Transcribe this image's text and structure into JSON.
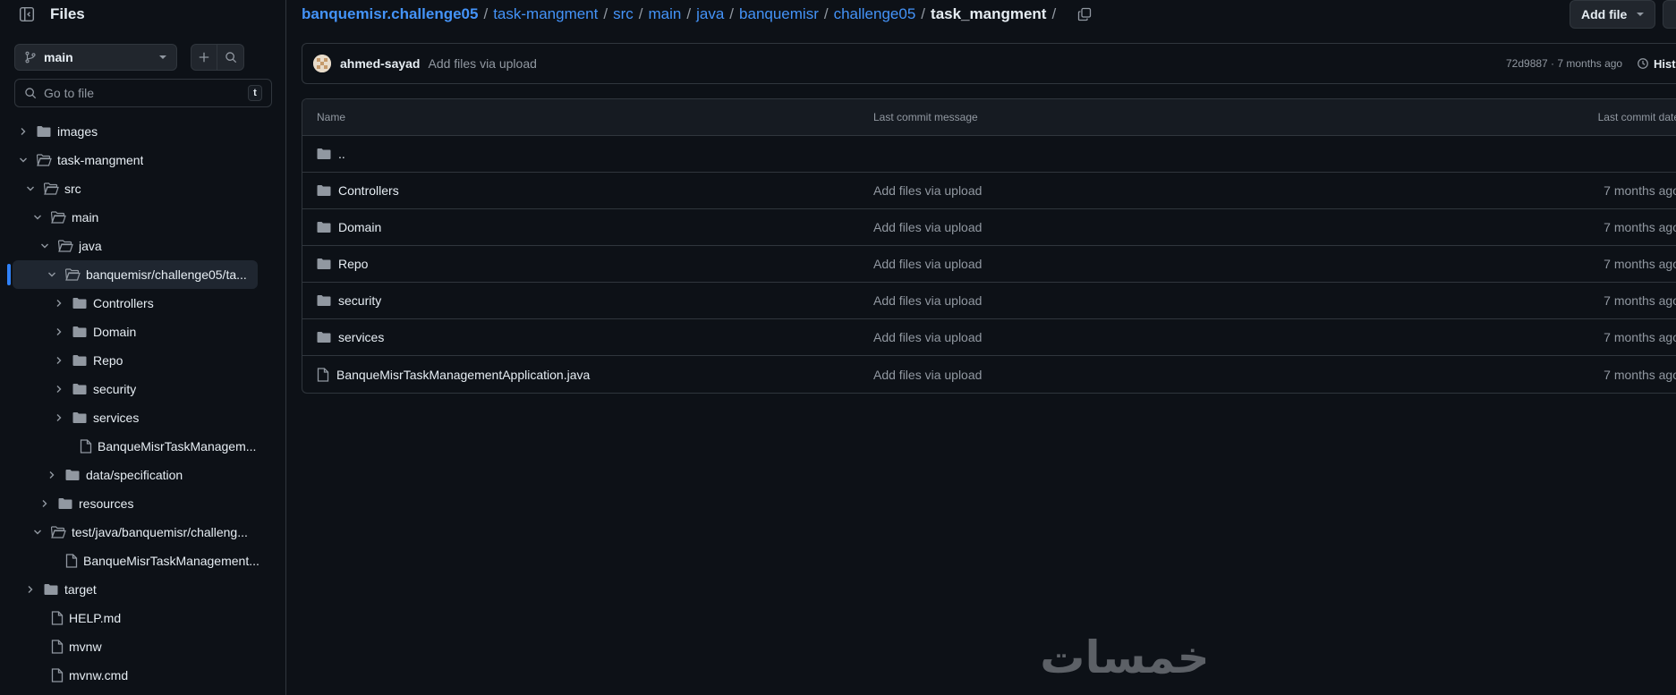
{
  "sidebar": {
    "title": "Files",
    "branch": "main",
    "goto_placeholder": "Go to file",
    "goto_shortcut": "t",
    "tree": [
      {
        "label": "images",
        "expanded": false,
        "type": "folder"
      },
      {
        "label": "task-mangment",
        "expanded": true,
        "type": "folder"
      },
      {
        "label": "src",
        "expanded": true,
        "type": "folder"
      },
      {
        "label": "main",
        "expanded": true,
        "type": "folder"
      },
      {
        "label": "java",
        "expanded": true,
        "type": "folder"
      },
      {
        "label": "banquemisr/challenge05/ta...",
        "expanded": true,
        "type": "folder",
        "active": true
      },
      {
        "label": "Controllers",
        "expanded": false,
        "type": "folder"
      },
      {
        "label": "Domain",
        "expanded": false,
        "type": "folder"
      },
      {
        "label": "Repo",
        "expanded": false,
        "type": "folder"
      },
      {
        "label": "security",
        "expanded": false,
        "type": "folder"
      },
      {
        "label": "services",
        "expanded": false,
        "type": "folder"
      },
      {
        "label": "BanqueMisrTaskManagem...",
        "type": "file"
      },
      {
        "label": "data/specification",
        "expanded": false,
        "type": "folder"
      },
      {
        "label": "resources",
        "expanded": false,
        "type": "folder"
      },
      {
        "label": "test/java/banquemisr/challeng...",
        "expanded": true,
        "type": "folder"
      },
      {
        "label": "BanqueMisrTaskManagement...",
        "type": "file"
      },
      {
        "label": "target",
        "expanded": false,
        "type": "folder"
      },
      {
        "label": "HELP.md",
        "type": "file"
      },
      {
        "label": "mvnw",
        "type": "file"
      },
      {
        "label": "mvnw.cmd",
        "type": "file"
      }
    ]
  },
  "breadcrumb": {
    "repo": "banquemisr.challenge05",
    "parts": [
      "task-mangment",
      "src",
      "main",
      "java",
      "banquemisr",
      "challenge05"
    ],
    "current": "task_mangment",
    "trailing_sep": "/"
  },
  "toolbar": {
    "add_file_label": "Add file",
    "more_label": "··"
  },
  "commit": {
    "author": "ahmed-sayad",
    "message": "Add files via upload",
    "meta": "72d9887 · 7 months ago",
    "history_label": "History"
  },
  "table": {
    "headers": {
      "name": "Name",
      "message": "Last commit message",
      "date": "Last commit date"
    },
    "parent_label": "..",
    "rows": [
      {
        "name": "Controllers",
        "type": "folder",
        "message": "Add files via upload",
        "date": "7 months ago"
      },
      {
        "name": "Domain",
        "type": "folder",
        "message": "Add files via upload",
        "date": "7 months ago"
      },
      {
        "name": "Repo",
        "type": "folder",
        "message": "Add files via upload",
        "date": "7 months ago"
      },
      {
        "name": "security",
        "type": "folder",
        "message": "Add files via upload",
        "date": "7 months ago"
      },
      {
        "name": "services",
        "type": "folder",
        "message": "Add files via upload",
        "date": "7 months ago"
      },
      {
        "name": "BanqueMisrTaskManagementApplication.java",
        "type": "file",
        "message": "Add files via upload",
        "date": "7 months ago"
      }
    ]
  },
  "watermark": {
    "text": "خمسات"
  },
  "colors": {
    "accent": "#4493f8",
    "bg": "#0d1117",
    "border": "#30363d",
    "muted": "#9198a1",
    "folder": "#9198a1"
  }
}
